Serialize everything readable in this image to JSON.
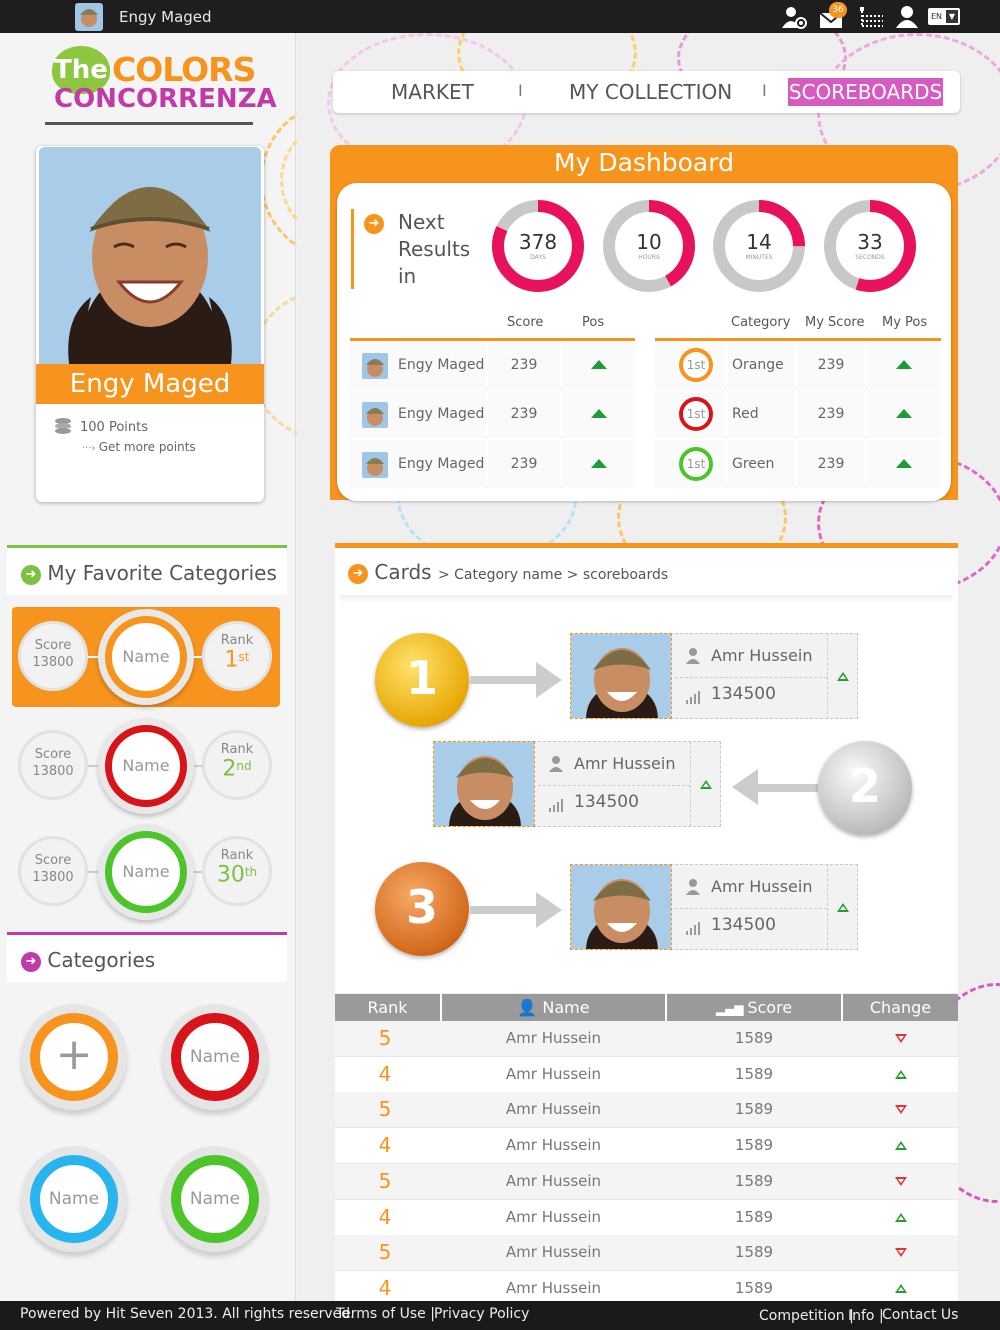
{
  "user": {
    "name": "Engy Maged",
    "points": "100 Points",
    "get_more": "Get more points"
  },
  "topbar": {
    "username": "Engy Maged",
    "messages_count": "36",
    "language": "EN"
  },
  "logo": {
    "the": "The",
    "colors": "COLORS",
    "concorrenza": "CONCORRENZA"
  },
  "nav": {
    "market": "MARKET",
    "my_collection": "MY COLLECTION",
    "scoreboards": "SCOREBOARDS",
    "separator": "I"
  },
  "dashboard": {
    "title": "My Dashboard",
    "next_results": [
      "Next",
      "Results",
      "in"
    ],
    "timers": [
      {
        "value": "378",
        "label": "DAYS",
        "fraction": 0.82
      },
      {
        "value": "10",
        "label": "HOURS",
        "fraction": 0.42
      },
      {
        "value": "14",
        "label": "MINUTES",
        "fraction": 0.25
      },
      {
        "value": "33",
        "label": "SECONDS",
        "fraction": 0.55
      }
    ],
    "left_table": {
      "headers": {
        "score": "Score",
        "pos": "Pos"
      },
      "rows": [
        {
          "name": "Engy Maged",
          "score": "239"
        },
        {
          "name": "Engy Maged",
          "score": "239"
        },
        {
          "name": "Engy Maged",
          "score": "239"
        }
      ]
    },
    "right_table": {
      "headers": {
        "category": "Category",
        "my_score": "My Score",
        "my_pos": "My Pos"
      },
      "rows": [
        {
          "badge": "1st",
          "category": "Orange",
          "score": "239",
          "color": "#f7941d"
        },
        {
          "badge": "1st",
          "category": "Red",
          "score": "239",
          "color": "#d7141a"
        },
        {
          "badge": "1st",
          "category": "Green",
          "score": "239",
          "color": "#4ec42b"
        }
      ]
    }
  },
  "favorites": {
    "title": "My Favorite Categories",
    "rows": [
      {
        "score_label": "Score",
        "score": "13800",
        "name": "Name",
        "rank_label": "Rank",
        "rank_num": "1",
        "rank_suffix": "st",
        "color": "#f7941d"
      },
      {
        "score_label": "Score",
        "score": "13800",
        "name": "Name",
        "rank_label": "Rank",
        "rank_num": "2",
        "rank_suffix": "nd",
        "color": "#d7141a"
      },
      {
        "score_label": "Score",
        "score": "13800",
        "name": "Name",
        "rank_label": "Rank",
        "rank_num": "30",
        "rank_suffix": "th",
        "color": "#4ec42b"
      }
    ]
  },
  "categories": {
    "title": "Categories",
    "items": [
      {
        "label": "+",
        "color": "#f7941d"
      },
      {
        "label": "Name",
        "color": "#d7141a"
      },
      {
        "label": "Name",
        "color": "#28b4ee"
      },
      {
        "label": "Name",
        "color": "#4ec42b"
      }
    ]
  },
  "cards": {
    "title": "Cards",
    "breadcrumb": "> Category name > scoreboards",
    "podium": [
      {
        "medal": "1",
        "name": "Amr Hussein",
        "score": "134500"
      },
      {
        "medal": "2",
        "name": "Amr Hussein",
        "score": "134500"
      },
      {
        "medal": "3",
        "name": "Amr Hussein",
        "score": "134500"
      }
    ]
  },
  "ranking": {
    "headers": {
      "rank": "Rank",
      "name": "Name",
      "score": "Score",
      "change": "Change"
    },
    "rows": [
      {
        "rank": "5",
        "name": "Amr Hussein",
        "score": "1589",
        "change": "down"
      },
      {
        "rank": "4",
        "name": "Amr Hussein",
        "score": "1589",
        "change": "up"
      },
      {
        "rank": "5",
        "name": "Amr Hussein",
        "score": "1589",
        "change": "down"
      },
      {
        "rank": "4",
        "name": "Amr Hussein",
        "score": "1589",
        "change": "up"
      },
      {
        "rank": "5",
        "name": "Amr Hussein",
        "score": "1589",
        "change": "down"
      },
      {
        "rank": "4",
        "name": "Amr Hussein",
        "score": "1589",
        "change": "up"
      },
      {
        "rank": "5",
        "name": "Amr Hussein",
        "score": "1589",
        "change": "down"
      },
      {
        "rank": "4",
        "name": "Amr Hussein",
        "score": "1589",
        "change": "up"
      }
    ]
  },
  "footer": {
    "powered": "Powered by Hit Seven 2013. All rights reserved.",
    "terms": "Terms of Use |",
    "privacy": "Privacy Policy",
    "competition": "Competition |",
    "info": "Info |",
    "contact": "Contact  Us"
  },
  "colors": {
    "orange": "#f7941d",
    "magenta": "#d55bc0",
    "green": "#7cc142",
    "pink": "#e8115c"
  }
}
